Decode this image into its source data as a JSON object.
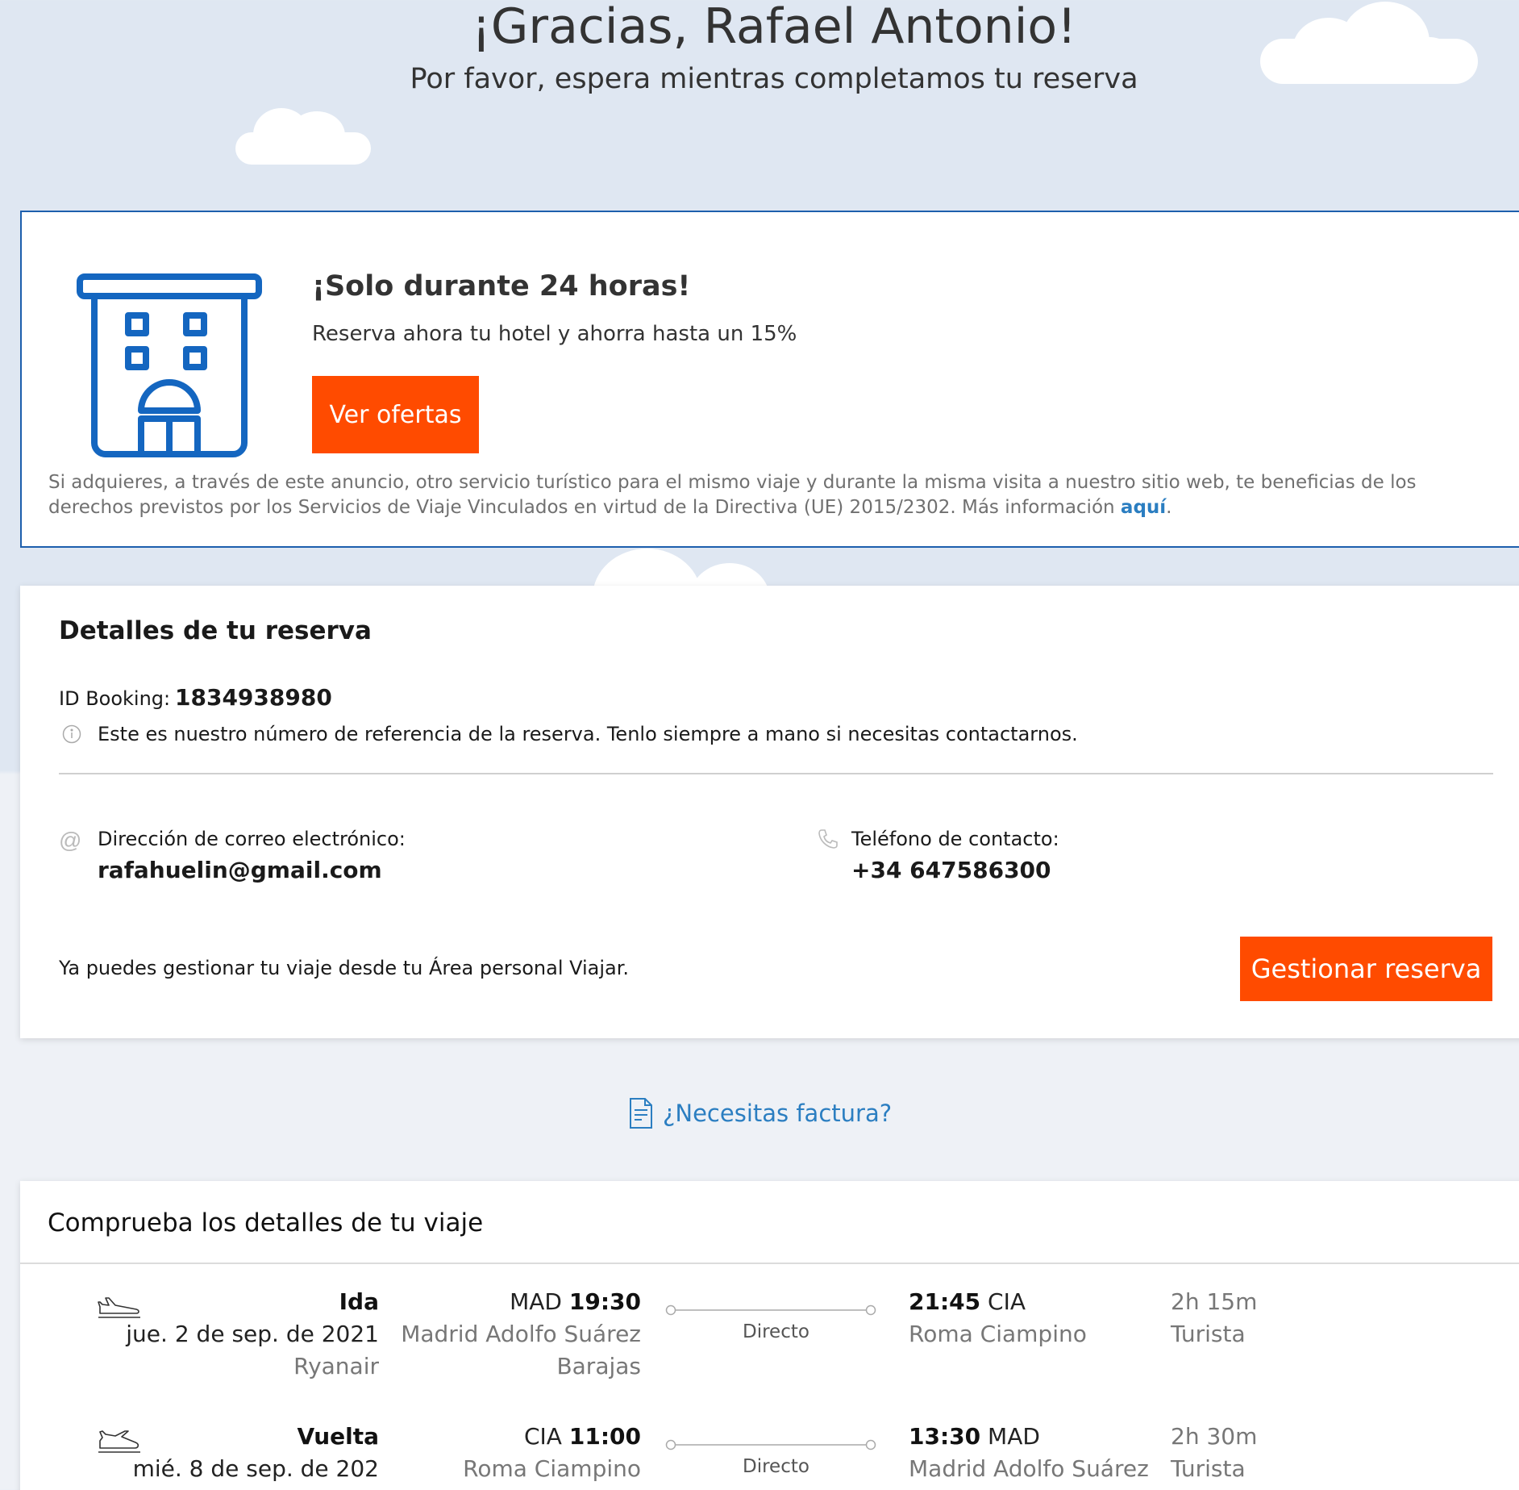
{
  "hero": {
    "title": "¡Gracias, Rafael Antonio!",
    "subtitle": "Por favor, espera mientras completamos tu reserva"
  },
  "promo": {
    "title": "¡Solo durante 24 horas!",
    "text": "Reserva ahora tu hotel y ahorra hasta un 15%",
    "button": "Ver ofertas",
    "legal": "Si adquieres, a través de este anuncio, otro servicio turístico para el mismo viaje y durante la misma visita a nuestro sitio web, te beneficias de los derechos previstos por los Servicios de Viaje Vinculados en virtud de la Directiva (UE) 2015/2302. Más información",
    "legal_link": "aquí",
    "legal_end": "."
  },
  "booking": {
    "title": "Detalles de tu reserva",
    "id_label": "ID Booking:",
    "id_value": "1834938980",
    "info": "Este es nuestro número de referencia de la reserva. Tenlo siempre a mano si necesitas contactarnos.",
    "email_label": "Dirección de correo electrónico:",
    "email_value": "rafahuelin@gmail.com",
    "phone_label": "Teléfono de contacto:",
    "phone_value": "+34 647586300",
    "manage_text": "Ya puedes gestionar tu viaje desde tu Área personal Viajar.",
    "manage_button": "Gestionar reserva"
  },
  "invoice": {
    "label": "¿Necesitas factura?"
  },
  "trip": {
    "title": "Comprueba los detalles de tu viaje",
    "legs": [
      {
        "type": "Ida",
        "date": "jue. 2 de sep. de 2021",
        "airline": "Ryanair",
        "dep_code": "MAD",
        "dep_time": "19:30",
        "dep_airport_1": "Madrid Adolfo Suárez",
        "dep_airport_2": "Barajas",
        "stops": "Directo",
        "arr_time": "21:45",
        "arr_code": "CIA",
        "arr_airport_1": "Roma Ciampino",
        "duration": "2h 15m",
        "cabin": "Turista"
      },
      {
        "type": "Vuelta",
        "date": "mié. 8 de sep. de 202",
        "dep_code": "CIA",
        "dep_time": "11:00",
        "dep_airport_1": "Roma Ciampino",
        "stops": "Directo",
        "arr_time": "13:30",
        "arr_code": "MAD",
        "arr_airport_1": "Madrid Adolfo Suárez",
        "duration": "2h 30m",
        "cabin": "Turista"
      }
    ]
  },
  "colors": {
    "accent_orange": "#ff4b00",
    "brand_blue": "#1d5fad",
    "link_blue": "#2b7ec1",
    "sky": "#dfe7f2"
  },
  "icons": [
    "hotel-icon",
    "info-icon",
    "at-icon",
    "phone-icon",
    "invoice-icon",
    "plane-takeoff-icon",
    "plane-landing-icon"
  ]
}
